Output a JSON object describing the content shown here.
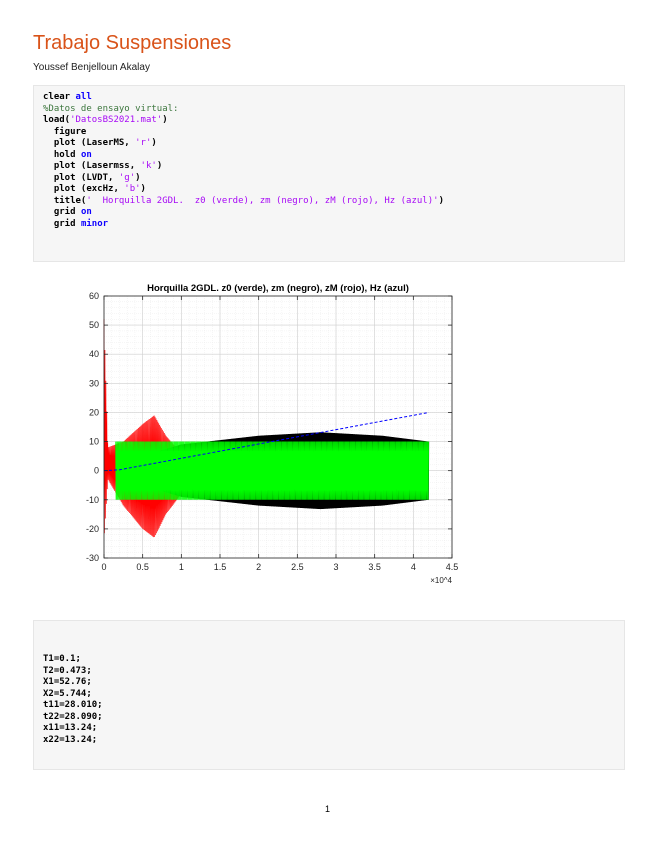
{
  "doc": {
    "title": "Trabajo Suspensiones",
    "author": "Youssef Benjelloun Akalay",
    "page_number": "1"
  },
  "code_block_1": [
    [
      {
        "t": "clear ",
        "c": "n"
      },
      {
        "t": "all",
        "c": "kw"
      }
    ],
    [
      {
        "t": "%Datos de ensayo virtual:",
        "c": "cm"
      }
    ],
    [
      {
        "t": "load(",
        "c": "n"
      },
      {
        "t": "'DatosBS2021.mat'",
        "c": "st"
      },
      {
        "t": ")",
        "c": "n"
      }
    ],
    [
      {
        "t": "  figure",
        "c": "n"
      }
    ],
    [
      {
        "t": "  plot (LaserMS, ",
        "c": "n"
      },
      {
        "t": "'r'",
        "c": "st"
      },
      {
        "t": ")",
        "c": "n"
      }
    ],
    [
      {
        "t": "  hold ",
        "c": "n"
      },
      {
        "t": "on",
        "c": "kw"
      }
    ],
    [
      {
        "t": "  plot (Lasermss, ",
        "c": "n"
      },
      {
        "t": "'k'",
        "c": "st"
      },
      {
        "t": ")",
        "c": "n"
      }
    ],
    [
      {
        "t": "  plot (LVDT, ",
        "c": "n"
      },
      {
        "t": "'g'",
        "c": "st"
      },
      {
        "t": ")",
        "c": "n"
      }
    ],
    [
      {
        "t": "  plot (excHz, ",
        "c": "n"
      },
      {
        "t": "'b'",
        "c": "st"
      },
      {
        "t": ")",
        "c": "n"
      }
    ],
    [
      {
        "t": "  title(",
        "c": "n"
      },
      {
        "t": "'  Horquilla 2GDL.  z0 (verde), zm (negro), zM (rojo), Hz (azul)'",
        "c": "st"
      },
      {
        "t": ")",
        "c": "n"
      }
    ],
    [
      {
        "t": "  grid ",
        "c": "n"
      },
      {
        "t": "on",
        "c": "kw"
      }
    ],
    [
      {
        "t": "  grid ",
        "c": "n"
      },
      {
        "t": "minor",
        "c": "kw"
      }
    ]
  ],
  "code_block_2": [
    "T1=0.1;",
    "T2=0.473;",
    "X1=52.76;",
    "X2=5.744;",
    "t11=28.010;",
    "t22=28.090;",
    "x11=13.24;",
    "x22=13.24;"
  ],
  "colors": {
    "title": "#d95319",
    "red": "#ff0000",
    "black": "#000000",
    "green": "#00ff00",
    "blue": "#0000ff"
  },
  "chart_data": {
    "type": "line",
    "title": "Horquilla 2GDL.  z0 (verde), zm (negro), zM (rojo), Hz (azul)",
    "xlabel": "",
    "ylabel": "",
    "x_exponent_label": "×10^4",
    "xlim": [
      0,
      4.5
    ],
    "ylim": [
      -30,
      60
    ],
    "x_ticks": [
      "0",
      "0.5",
      "1",
      "1.5",
      "2",
      "2.5",
      "3",
      "3.5",
      "4",
      "4.5"
    ],
    "y_ticks": [
      "-30",
      "-20",
      "-10",
      "0",
      "10",
      "20",
      "30",
      "40",
      "50",
      "60"
    ],
    "grid": "major+minor",
    "series": [
      {
        "name": "zM (rojo)",
        "color": "red",
        "style": "oscillation",
        "envelope": {
          "x": [
            0,
            0.05,
            0.25,
            0.5,
            0.65,
            0.8,
            1.0,
            1.2
          ],
          "upper": [
            52,
            8,
            10,
            16,
            19,
            12,
            6,
            2
          ],
          "lower": [
            -24,
            -3,
            -12,
            -20,
            -23,
            -15,
            -8,
            -2
          ]
        }
      },
      {
        "name": "zm (negro)",
        "color": "black",
        "style": "oscillation",
        "envelope": {
          "x": [
            0.2,
            0.5,
            1.0,
            2.0,
            2.8,
            3.6,
            4.2
          ],
          "upper": [
            2,
            5,
            9,
            12,
            13.2,
            12,
            10
          ],
          "lower": [
            -2,
            -5,
            -9,
            -12,
            -13.2,
            -12,
            -10
          ]
        }
      },
      {
        "name": "z0 (verde)",
        "color": "green",
        "style": "oscillation",
        "envelope": {
          "x": [
            0.15,
            0.4,
            0.6,
            1.0,
            4.2
          ],
          "upper": [
            10,
            10,
            10,
            10,
            10
          ],
          "lower": [
            -10,
            -10,
            -10,
            -10,
            -10
          ]
        }
      },
      {
        "name": "Hz (azul)",
        "color": "blue",
        "style": "dashed",
        "x": [
          0,
          0.2,
          4.2
        ],
        "y": [
          0,
          0.3,
          20
        ]
      }
    ]
  }
}
